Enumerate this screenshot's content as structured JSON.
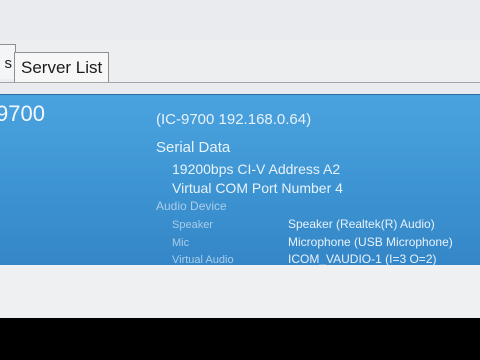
{
  "tabs": {
    "prev_fragment": "s",
    "server_list": "Server List"
  },
  "radio": {
    "name_fragment": "9700",
    "connection": "(IC-9700 192.168.0.64)",
    "serial_title": "Serial Data",
    "serial_speed": "19200bps  CI-V Address A2",
    "serial_port": "Virtual COM Port Number 4",
    "audio_title": "Audio Device",
    "audio_rows": [
      {
        "label": "Speaker",
        "value": "Speaker (Realtek(R) Audio)"
      },
      {
        "label": "Mic",
        "value": "Microphone (USB Microphone)"
      },
      {
        "label": "Virtual Audio",
        "value": "ICOM_VAUDIO-1 (I=3 O=2)"
      }
    ]
  }
}
